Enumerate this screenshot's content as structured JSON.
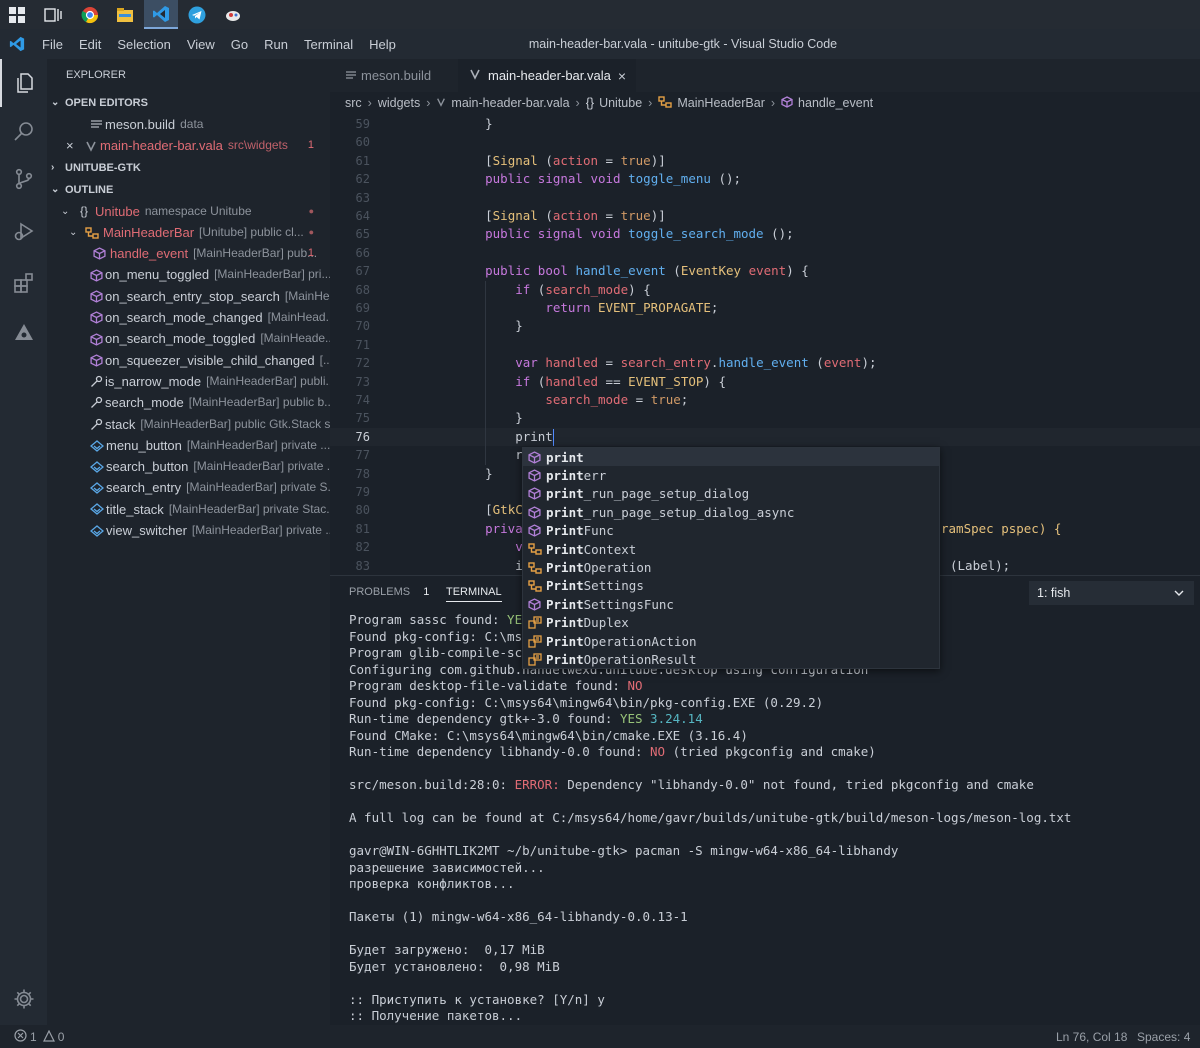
{
  "window": {
    "title": "main-header-bar.vala - unitube-gtk - Visual Studio Code"
  },
  "menu": [
    "File",
    "Edit",
    "Selection",
    "View",
    "Go",
    "Run",
    "Terminal",
    "Help"
  ],
  "sidebar": {
    "title": "EXPLORER",
    "open_editors": {
      "label": "OPEN EDITORS",
      "items": [
        {
          "name": "meson.build",
          "desc": "data",
          "badge": ""
        },
        {
          "name": "main-header-bar.vala",
          "desc": "src\\widgets",
          "badge": "1"
        }
      ]
    },
    "project": {
      "label": "UNITUBE-GTK"
    },
    "outline": {
      "label": "OUTLINE",
      "items": [
        {
          "name": "Unitube",
          "desc": "namespace Unitube",
          "badge": "●",
          "kind": "namespace"
        },
        {
          "name": "MainHeaderBar",
          "desc": "[Unitube] public cl...",
          "badge": "●",
          "kind": "class"
        },
        {
          "name": "handle_event",
          "desc": "[MainHeaderBar] pub...",
          "badge": "1",
          "kind": "method"
        },
        {
          "name": "on_menu_toggled",
          "desc": "[MainHeaderBar] pri...",
          "badge": "",
          "kind": "method"
        },
        {
          "name": "on_search_entry_stop_search",
          "desc": "[MainHe...",
          "badge": "",
          "kind": "method"
        },
        {
          "name": "on_search_mode_changed",
          "desc": "[MainHead...",
          "badge": "",
          "kind": "method"
        },
        {
          "name": "on_search_mode_toggled",
          "desc": "[MainHeade...",
          "badge": "",
          "kind": "method"
        },
        {
          "name": "on_squeezer_visible_child_changed",
          "desc": "[...",
          "badge": "",
          "kind": "method"
        },
        {
          "name": "is_narrow_mode",
          "desc": "[MainHeaderBar] publi...",
          "badge": "",
          "kind": "property"
        },
        {
          "name": "search_mode",
          "desc": "[MainHeaderBar] public b...",
          "badge": "",
          "kind": "property"
        },
        {
          "name": "stack",
          "desc": "[MainHeaderBar] public Gtk.Stack s...",
          "badge": "",
          "kind": "property"
        },
        {
          "name": "menu_button",
          "desc": "[MainHeaderBar] private ...",
          "badge": "",
          "kind": "field"
        },
        {
          "name": "search_button",
          "desc": "[MainHeaderBar] private ...",
          "badge": "",
          "kind": "field"
        },
        {
          "name": "search_entry",
          "desc": "[MainHeaderBar] private S...",
          "badge": "",
          "kind": "field"
        },
        {
          "name": "title_stack",
          "desc": "[MainHeaderBar] private Stac...",
          "badge": "",
          "kind": "field"
        },
        {
          "name": "view_switcher",
          "desc": "[MainHeaderBar] private ...",
          "badge": "",
          "kind": "field"
        }
      ]
    }
  },
  "tabs": [
    {
      "label": "meson.build"
    },
    {
      "label": "main-header-bar.vala"
    }
  ],
  "breadcrumb": [
    "src",
    "widgets",
    "main-header-bar.vala",
    "Unitube",
    "MainHeaderBar",
    "handle_event"
  ],
  "editor": {
    "line_numbers": [
      "59",
      "60",
      "61",
      "62",
      "63",
      "64",
      "65",
      "66",
      "67",
      "68",
      "69",
      "70",
      "71",
      "72",
      "73",
      "74",
      "75",
      "76",
      "77",
      "78",
      "79",
      "80",
      "81",
      "82",
      "83"
    ],
    "lines": [
      "    }",
      "",
      "    [Signal (action = true)]",
      "    public signal void toggle_menu ();",
      "",
      "    [Signal (action = true)]",
      "    public signal void toggle_search_mode ();",
      "",
      "    public bool handle_event (EventKey event) {",
      "        if (search_mode) {",
      "            return EVENT_PROPAGATE;",
      "        }",
      "",
      "        var handled = search_entry.handle_event (event);",
      "        if (handled == EVENT_STOP) {",
      "            search_mode = true;",
      "        }",
      "        print",
      "        retur",
      "    }",
      "",
      "    [GtkCallb",
      "    private v",
      "        var s",
      "        is na"
    ],
    "overflow_right": {
      "line81": "ramSpec pspec) {",
      "line83": "(Label);"
    }
  },
  "suggest": [
    {
      "match": "print",
      "rest": "",
      "kind": "method"
    },
    {
      "match": "print",
      "rest": "err",
      "kind": "method"
    },
    {
      "match": "print",
      "rest": "_run_page_setup_dialog",
      "kind": "method"
    },
    {
      "match": "print",
      "rest": "_run_page_setup_dialog_async",
      "kind": "method"
    },
    {
      "match": "Print",
      "rest": "Func",
      "kind": "method"
    },
    {
      "match": "Print",
      "rest": "Context",
      "kind": "class"
    },
    {
      "match": "Print",
      "rest": "Operation",
      "kind": "class"
    },
    {
      "match": "Print",
      "rest": "Settings",
      "kind": "class"
    },
    {
      "match": "Print",
      "rest": "SettingsFunc",
      "kind": "method"
    },
    {
      "match": "Print",
      "rest": "Duplex",
      "kind": "enum"
    },
    {
      "match": "Print",
      "rest": "OperationAction",
      "kind": "enum"
    },
    {
      "match": "Print",
      "rest": "OperationResult",
      "kind": "enum"
    }
  ],
  "panel": {
    "problems_label": "PROBLEMS",
    "problems_count": "1",
    "terminal_label": "TERMINAL",
    "terminal_select": "1: fish",
    "lines": [
      "Program sassc found: YES (",
      "Found pkg-config: C:\\msys6",
      "Program glib-compile-schem",
      "Configuring com.github.nahuelwexd.unitube.desktop using configuration",
      "Program desktop-file-validate found: NO",
      "Found pkg-config: C:\\msys64\\mingw64\\bin/pkg-config.EXE (0.29.2)",
      "Run-time dependency gtk+-3.0 found: YES 3.24.14",
      "Found CMake: C:\\msys64\\mingw64\\bin/cmake.EXE (3.16.4)",
      "Run-time dependency libhandy-0.0 found: NO (tried pkgconfig and cmake)",
      "",
      "src/meson.build:28:0: ERROR: Dependency \"libhandy-0.0\" not found, tried pkgconfig and cmake",
      "",
      "A full log can be found at C:/msys64/home/gavr/builds/unitube-gtk/build/meson-logs/meson-log.txt",
      "",
      "gavr@WIN-6GHHTLIK2MT ~/b/unitube-gtk> pacman -S mingw-w64-x86_64-libhandy",
      "разрешение зависимостей...",
      "проверка конфликтов...",
      "",
      "Пакеты (1) mingw-w64-x86_64-libhandy-0.0.13-1",
      "",
      "Будет загружено:  0,17 MiB",
      "Будет установлено:  0,98 MiB",
      "",
      ":: Приступить к установке? [Y/n] y",
      ":: Получение пакетов..."
    ]
  },
  "status": {
    "errors": "1",
    "warnings": "0",
    "position": "Ln 76, Col 18",
    "spaces": "Spaces: 4"
  },
  "colors": {
    "accent": "#7da7d9",
    "error": "#e06c75",
    "ok": "#98c379",
    "keyword": "#c678dd",
    "function": "#61afef",
    "property": "#e06c75",
    "constant": "#e5c07b"
  }
}
